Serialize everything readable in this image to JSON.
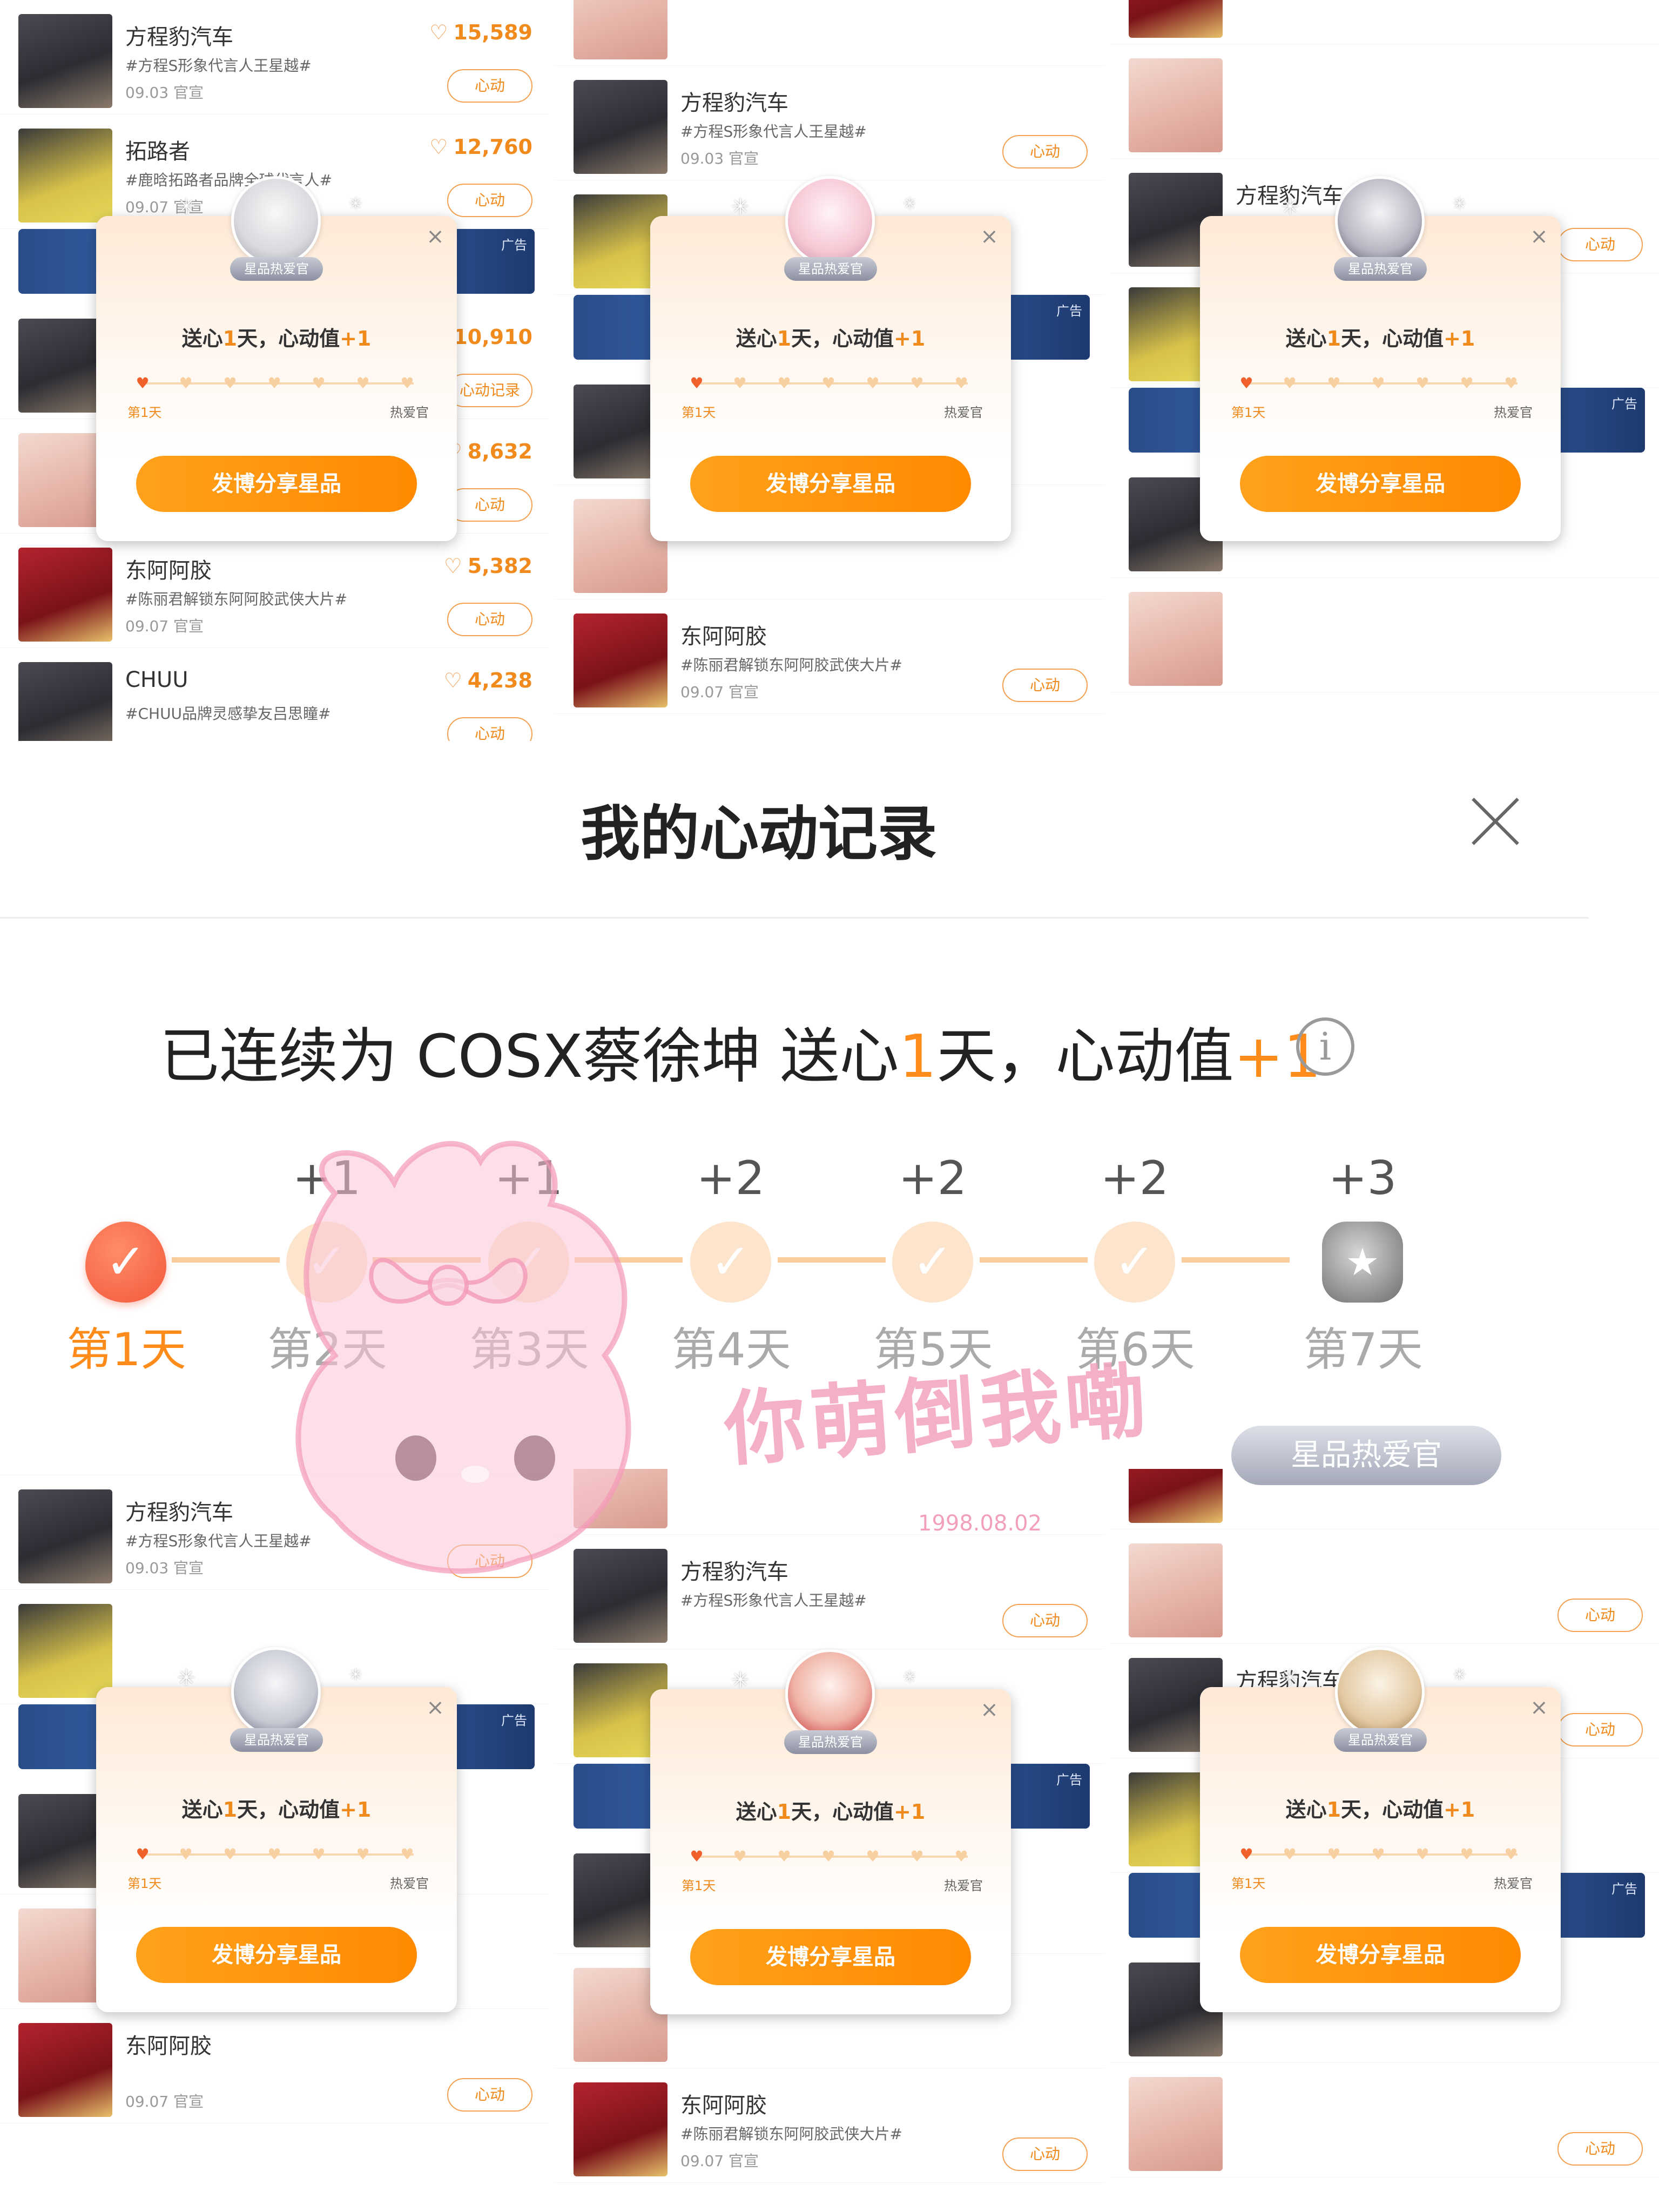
{
  "feed_items": [
    {
      "name": "方程豹汽车",
      "tag": "#方程S形象代言人王星越#",
      "date": "09.03 官宣",
      "count": "15,589",
      "action": "心动"
    },
    {
      "name": "拓路者",
      "tag": "#鹿晗拓路者品牌全球代言人#",
      "date": "09.07 官宣",
      "count": "12,760",
      "action": "心动"
    },
    {
      "name": "",
      "tag": "",
      "date": "",
      "count": "10,910",
      "action": "心动记录"
    },
    {
      "name": "",
      "tag": "",
      "date": "",
      "count": "8,632",
      "action": "心动"
    },
    {
      "name": "东阿阿胶",
      "tag": "#陈丽君解锁东阿阿胶武侠大片#",
      "date": "09.07 官宣",
      "count": "5,382",
      "action": "心动"
    },
    {
      "name": "CHUU",
      "tag": "#CHUU品牌灵感挚友吕思瞳#",
      "date": "",
      "count": "4,238",
      "action": "心动"
    }
  ],
  "ad_label": "广告",
  "popup": {
    "badge": "星品热爱官",
    "text_prefix": "送心",
    "text_days": "1",
    "text_mid": "天，心动值",
    "text_plus": "+1",
    "day1": "第1天",
    "day7": "热爱官",
    "share_button": "发博分享星品",
    "close": "×"
  },
  "modal": {
    "title": "我的心动记录",
    "streak_prefix": "已连续为 COSX蔡徐坤 送心",
    "streak_days": "1",
    "streak_mid": "天，心动值",
    "streak_plus": "+1",
    "info_icon": "i",
    "days": [
      {
        "label": "第1天",
        "plus": ""
      },
      {
        "label": "第2天",
        "plus": "+1"
      },
      {
        "label": "第3天",
        "plus": "+1"
      },
      {
        "label": "第4天",
        "plus": "+2"
      },
      {
        "label": "第5天",
        "plus": "+2"
      },
      {
        "label": "第6天",
        "plus": "+2"
      },
      {
        "label": "第7天",
        "plus": "+3"
      }
    ]
  },
  "sticker": {
    "text": "你萌倒我嘞",
    "date": "1998.08.02",
    "badge": "星品热爱官"
  },
  "colors": {
    "accent": "#ff8c1a",
    "heart_on": "#f2573a",
    "track": "#f9cd9e"
  }
}
